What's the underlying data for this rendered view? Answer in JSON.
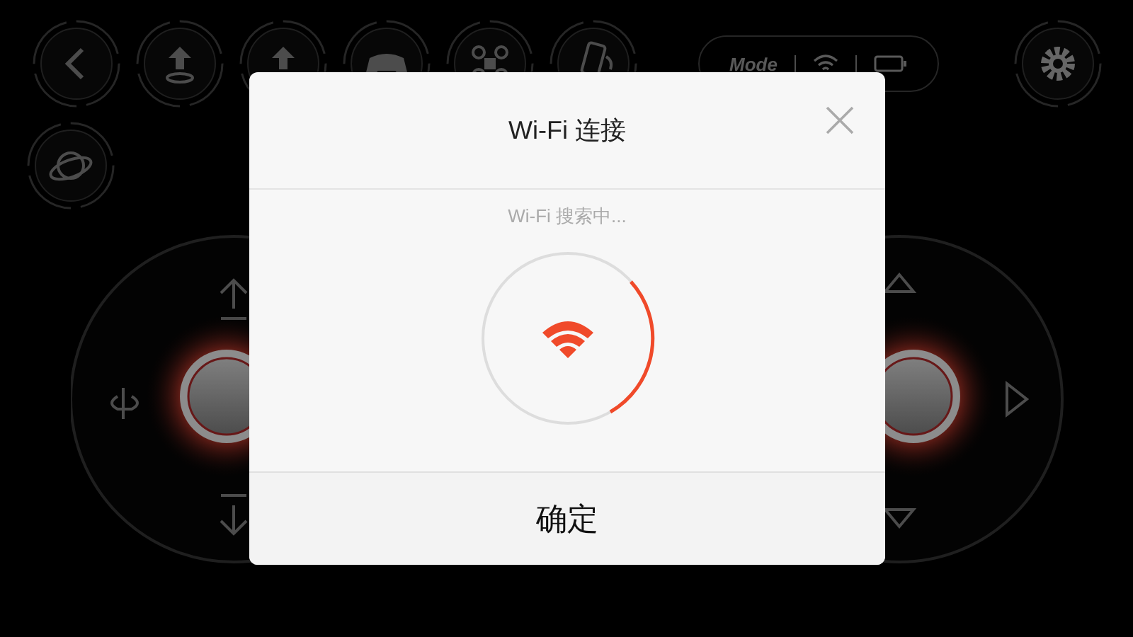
{
  "hud": {
    "mode_label": "Mode"
  },
  "dialog": {
    "title": "Wi-Fi 连接",
    "status": "Wi-Fi 搜索中...",
    "confirm_button": "确定"
  }
}
